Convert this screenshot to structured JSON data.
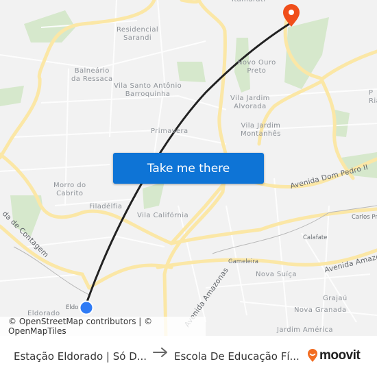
{
  "map": {
    "neighborhoods": [
      {
        "name": "Residencial\nSarandi"
      },
      {
        "name": "Balneário\nda Ressaca"
      },
      {
        "name": "Vila Santo Antônio\nBarroquinha"
      },
      {
        "name": "Primavera"
      },
      {
        "name": "Novo Ouro\nPreto"
      },
      {
        "name": "Vila Jardim\nAlvorada"
      },
      {
        "name": "Vila Jardim\nMontanhês"
      },
      {
        "name": "Morro do\nCabrito"
      },
      {
        "name": "Filadélfia"
      },
      {
        "name": "Vila Califórnia"
      },
      {
        "name": "Nova Suíça"
      },
      {
        "name": "Grajaú"
      },
      {
        "name": "Nova Granada"
      },
      {
        "name": "Jardim América"
      },
      {
        "name": "Eldorado"
      },
      {
        "name": "Itamarati"
      },
      {
        "name": "P\nRia"
      }
    ],
    "small_labels": [
      "Gameleira",
      "Calafate",
      "Carlos Pr",
      "Eldo"
    ],
    "roads": [
      "Avenida Dom Pedro II",
      "Avenida Amazonas",
      "Avenida Amazonas",
      "da de Contagem"
    ],
    "origin_marker": {
      "color": "#2f7bf5"
    },
    "destination_marker": {
      "color": "#f04e1a"
    },
    "route_color": "#222222"
  },
  "cta": {
    "label": "Take me there",
    "color": "#0e74d6"
  },
  "attribution": "© OpenStreetMap contributors | © OpenMapTiles",
  "footer": {
    "origin": "Estação Eldorado | Só D...",
    "destination": "Escola De Educação Fí...",
    "arrow_icon": "arrow-right-icon",
    "brand": "moovit",
    "brand_color": "#f26c21"
  }
}
